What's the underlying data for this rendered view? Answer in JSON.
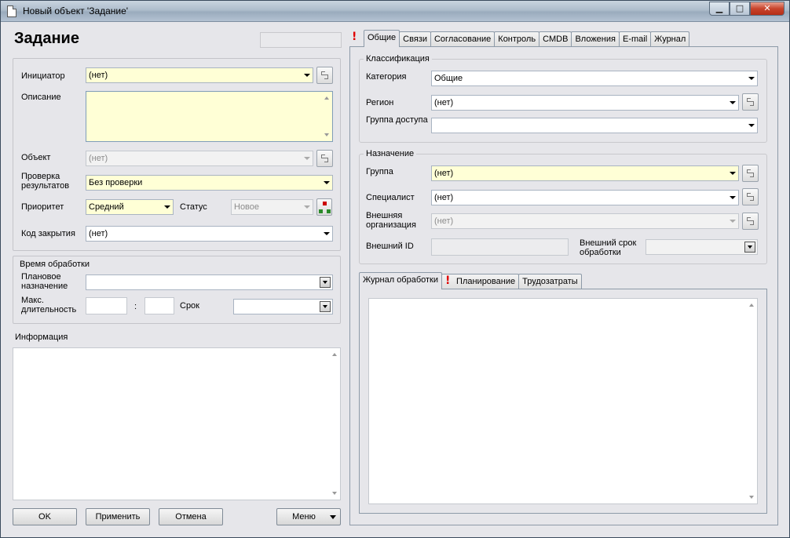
{
  "window": {
    "title": "Новый объект 'Задание'",
    "btn_min": "▁",
    "btn_max": "□",
    "btn_close": "✕"
  },
  "header": {
    "title": "Задание"
  },
  "left": {
    "initiator_label": "Инициатор",
    "initiator_value": "(нет)",
    "description_label": "Описание",
    "object_label": "Объект",
    "object_value": "(нет)",
    "check_label": "Проверка результатов",
    "check_value": "Без проверки",
    "priority_label": "Приоритет",
    "priority_value": "Средний",
    "status_label": "Статус",
    "status_value": "Новое",
    "closing_code_label": "Код закрытия",
    "closing_code_value": "(нет)"
  },
  "processing": {
    "group_label": "Время обработки",
    "planned_label": "Плановое назначение",
    "max_duration_label": "Макс. длительность",
    "colon": ":",
    "deadline_label": "Срок"
  },
  "info": {
    "label": "Информация"
  },
  "buttons": {
    "ok": "OK",
    "apply": "Применить",
    "cancel": "Отмена",
    "menu": "Меню"
  },
  "tabs": [
    "Общие",
    "Связи",
    "Согласование",
    "Контроль",
    "CMDB",
    "Вложения",
    "E-mail",
    "Журнал"
  ],
  "excl": "!",
  "classification": {
    "group_label": "Классификация",
    "category_label": "Категория",
    "category_value": "Общие",
    "region_label": "Регион",
    "region_value": "(нет)",
    "access_group_label": "Группа доступа"
  },
  "assignment": {
    "group_label": "Назначение",
    "group_field_label": "Группа",
    "group_value": "(нет)",
    "specialist_label": "Специалист",
    "specialist_value": "(нет)",
    "external_org_label": "Внешняя организация",
    "external_org_value": "(нет)",
    "external_id_label": "Внешний ID",
    "external_deadline_label": "Внешний срок обработки"
  },
  "subtabs": [
    "Журнал обработки",
    "Планирование",
    "Трудозатраты"
  ],
  "colors": {
    "required": "#ffffd6",
    "accent_red": "#e00000"
  }
}
